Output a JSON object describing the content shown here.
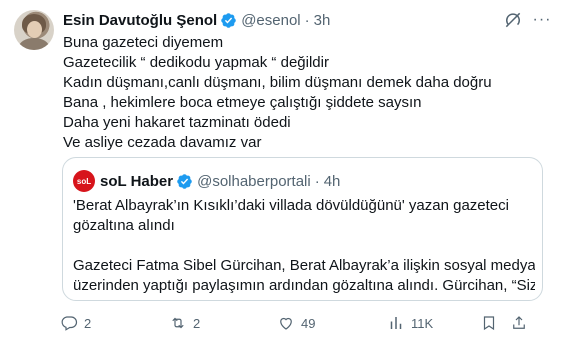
{
  "author": {
    "name": "Esin Davutoğlu Şenol",
    "handle": "@esenol",
    "time": "3h"
  },
  "tweet_lines": [
    "Buna gazeteci diyemem",
    "Gazetecilik “ dedikodu yapmak “ değildir",
    "Kadın düşmanı,canlı düşmanı, bilim düşmanı demek daha doğru",
    "Bana , hekimlere boca etmeye çalıştığı şiddete saysın",
    "Daha yeni hakaret tazminatı ödedi",
    "Ve asliye cezada davamız var"
  ],
  "quote": {
    "logo_text": "soL",
    "name": "soL Haber",
    "handle": "@solhaberportali",
    "time": "4h",
    "lines": [
      "'Berat Albayrak’ın Kısıklı’daki villada dövüldüğünü' yazan gazeteci",
      "gözaltına alındı",
      "",
      "Gazeteci Fatma Sibel Gürcihan, Berat Albayrak’a ilişkin sosyal medya",
      "üzerinden yaptığı paylaşımın ardından gözaltına alındı. Gürcihan, “Sizi ..."
    ]
  },
  "actions": {
    "replies": "2",
    "reposts": "2",
    "likes": "49",
    "views": "11K"
  },
  "colors": {
    "verified": "#1d9bf0",
    "muted": "#536471",
    "border": "#cfd9de",
    "sol_red": "#d7141b"
  }
}
